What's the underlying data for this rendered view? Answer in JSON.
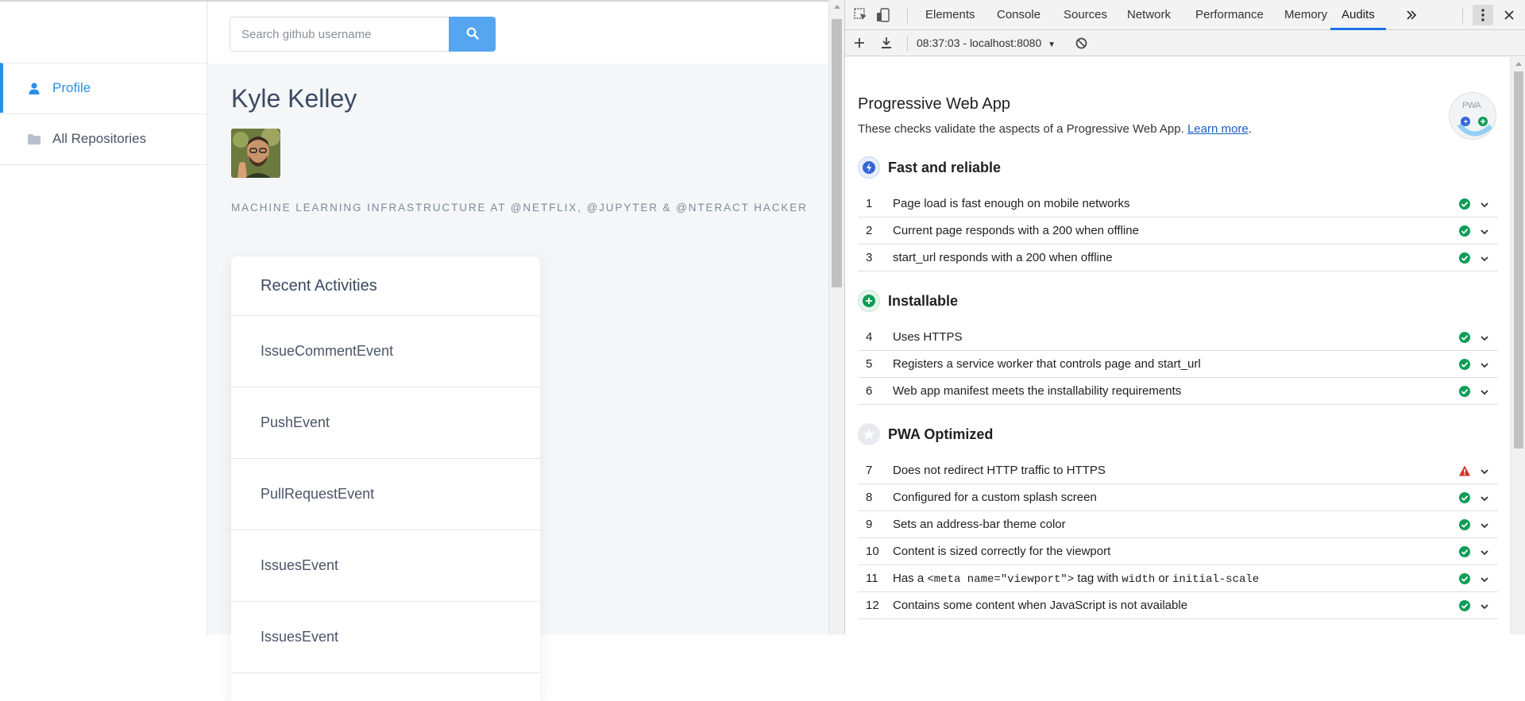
{
  "sidebar": {
    "items": [
      {
        "label": "Profile",
        "icon": "user-icon",
        "active": true
      },
      {
        "label": "All Repositories",
        "icon": "folder-icon",
        "active": false
      }
    ]
  },
  "search": {
    "placeholder": "Search github username",
    "value": ""
  },
  "profile": {
    "name": "Kyle Kelley",
    "bio": "MACHINE LEARNING INFRASTRUCTURE AT @NETFLIX, @JUPYTER & @NTERACT HACKER"
  },
  "activities": {
    "title": "Recent Activities",
    "items": [
      "IssueCommentEvent",
      "PushEvent",
      "PullRequestEvent",
      "IssuesEvent",
      "IssuesEvent"
    ]
  },
  "devtools": {
    "tabs": [
      "Elements",
      "Console",
      "Sources",
      "Network",
      "Performance",
      "Memory",
      "Audits"
    ],
    "active_tab": "Audits",
    "toolbar_text": "08:37:03 - localhost:8080",
    "report": {
      "title": "Progressive Web App",
      "description": "These checks validate the aspects of a Progressive Web App.",
      "learn_more": "Learn more",
      "badge": "PWA",
      "groups": [
        {
          "title": "Fast and reliable",
          "icon": "lightning-icon",
          "color": "#3367d6",
          "audits": [
            {
              "n": "1",
              "label": "Page load is fast enough on mobile networks",
              "status": "pass"
            },
            {
              "n": "2",
              "label": "Current page responds with a 200 when offline",
              "status": "pass"
            },
            {
              "n": "3",
              "label": "start_url responds with a 200 when offline",
              "status": "pass"
            }
          ]
        },
        {
          "title": "Installable",
          "icon": "plus-icon",
          "color": "#0f9d58",
          "audits": [
            {
              "n": "4",
              "label": "Uses HTTPS",
              "status": "pass"
            },
            {
              "n": "5",
              "label": "Registers a service worker that controls page and start_url",
              "status": "pass"
            },
            {
              "n": "6",
              "label": "Web app manifest meets the installability requirements",
              "status": "pass"
            }
          ]
        },
        {
          "title": "PWA Optimized",
          "icon": "star-icon",
          "color": "#bdc1c6",
          "audits": [
            {
              "n": "7",
              "label": "Does not redirect HTTP traffic to HTTPS",
              "status": "fail"
            },
            {
              "n": "8",
              "label": "Configured for a custom splash screen",
              "status": "pass"
            },
            {
              "n": "9",
              "label": "Sets an address-bar theme color",
              "status": "pass"
            },
            {
              "n": "10",
              "label": "Content is sized correctly for the viewport",
              "status": "pass"
            },
            {
              "n": "11",
              "label_parts": [
                "Has a ",
                "<meta name=\"viewport\">",
                " tag with ",
                "width",
                " or ",
                "initial-scale"
              ],
              "status": "pass"
            },
            {
              "n": "12",
              "label": "Contains some content when JavaScript is not available",
              "status": "pass"
            }
          ]
        }
      ]
    }
  },
  "colors": {
    "accent": "#2b8fe6",
    "search_button": "#55a5f0",
    "pass": "#0f9d58",
    "fail": "#d93025",
    "devtools_tab_active": "#1a73e8"
  }
}
